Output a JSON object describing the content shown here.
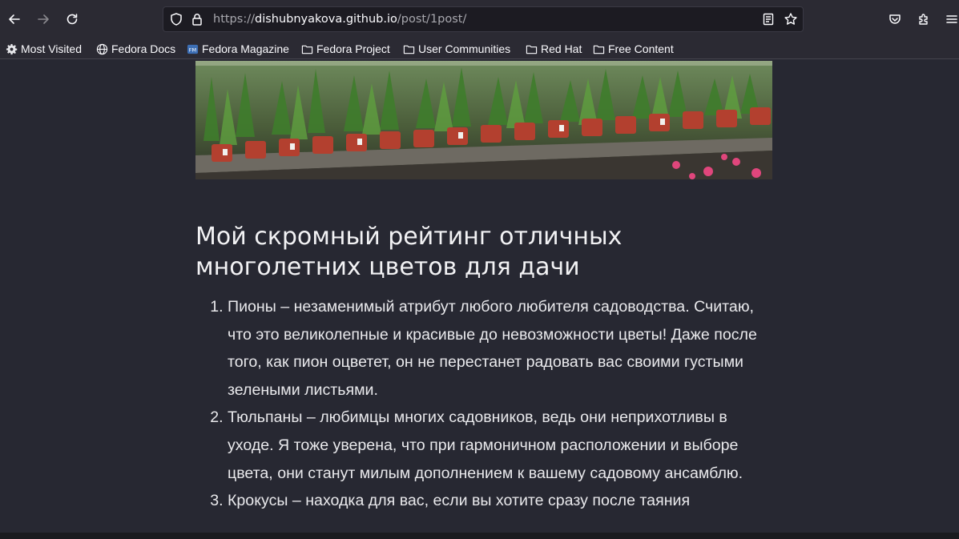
{
  "browser": {
    "url_domain": "dishubnyakova.github.io",
    "url_path": "/post/1post/",
    "url_scheme": "https://",
    "icons": {
      "back": "arrow-left-icon",
      "forward": "arrow-right-icon",
      "reload": "reload-icon",
      "tracking": "shield-icon",
      "lock": "lock-icon",
      "reader": "reader-view-icon",
      "bookmark": "star-icon",
      "pocket": "pocket-icon",
      "extensions": "puzzle-icon",
      "menu": "hamburger-menu-icon"
    }
  },
  "bookmarks": [
    {
      "label": "Most Visited",
      "icon": "gear-icon"
    },
    {
      "label": "Fedora Docs",
      "icon": "globe-icon"
    },
    {
      "label": "Fedora Magazine",
      "icon": "fm-favicon-icon"
    },
    {
      "label": "Fedora Project",
      "icon": "folder-icon"
    },
    {
      "label": "User Communities",
      "icon": "folder-icon"
    },
    {
      "label": "Red Hat",
      "icon": "folder-icon"
    },
    {
      "label": "Free Content",
      "icon": "folder-icon"
    }
  ],
  "post": {
    "title": "Мой скромный рейтинг отличных многолетних цветов для дачи",
    "items": [
      "Пионы – незаменимый атрибут любого любителя садоводства. Считаю, что это великолепные и красивые до невозможности цветы! Даже после того, как пион оцветет, он не перестанет радовать вас своими густыми зелеными листьями.",
      "Тюльпаны – любимцы многих садовников, ведь они неприхотливы в уходе. Я тоже уверена, что при гармоничном расположении и выборе цвета, они станут милым дополнением к вашему садовому ансамблю.",
      "Крокусы – находка для вас, если вы хотите сразу после таяния"
    ]
  },
  "colors": {
    "toolbar_bg": "#2b2a33",
    "page_bg": "#272832",
    "text": "#e9e9ec"
  }
}
